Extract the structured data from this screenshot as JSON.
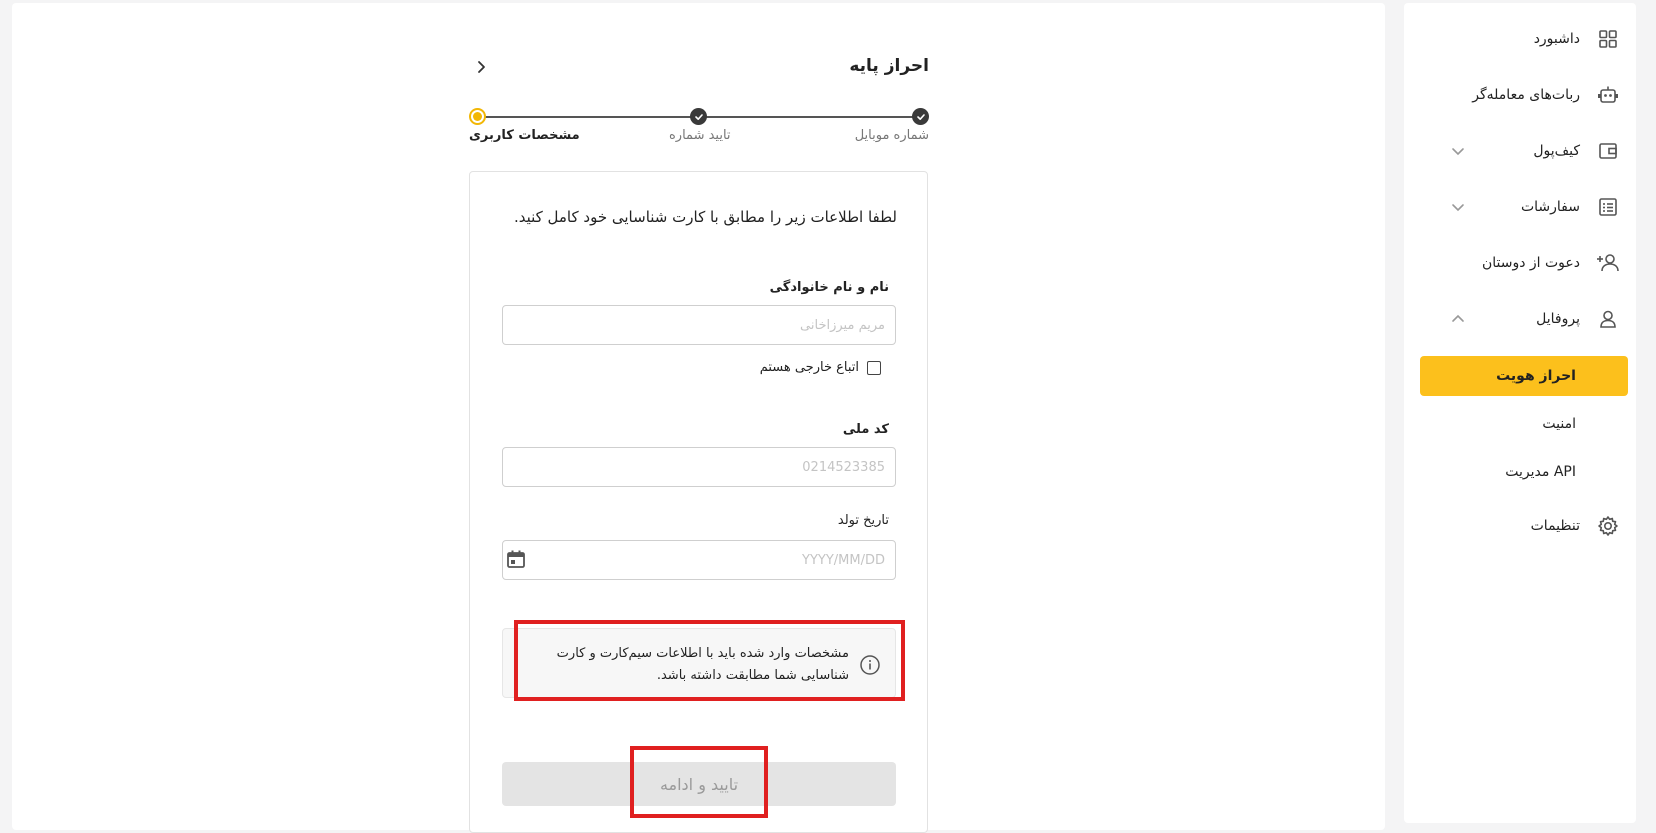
{
  "sidebar": {
    "items": [
      {
        "label": "داشبورد",
        "icon": "grid-icon"
      },
      {
        "label": "ربات‌های معامله‌گر",
        "icon": "robot-icon"
      },
      {
        "label": "کیف‌پول",
        "icon": "wallet-icon"
      },
      {
        "label": "سفارشات",
        "icon": "list-icon"
      },
      {
        "label": "دعوت از دوستان",
        "icon": "user-plus-icon"
      },
      {
        "label": "پروفایل",
        "icon": "user-icon"
      },
      {
        "label": "تنظیمات",
        "icon": "gear-icon"
      }
    ],
    "profile_sub": [
      {
        "label": "احراز هویت",
        "active": true
      },
      {
        "label": "امنیت",
        "active": false
      },
      {
        "label": "مدیریت API",
        "active": false
      }
    ]
  },
  "header": {
    "title": "احراز پایه"
  },
  "stepper": {
    "steps": [
      {
        "label": "شماره موبایل",
        "state": "done"
      },
      {
        "label": "تایید شماره",
        "state": "done"
      },
      {
        "label": "مشخصات کاربری",
        "state": "current"
      }
    ]
  },
  "form": {
    "intro": "لطفا اطلاعات زیر را مطابق با کارت شناسایی خود کامل کنید.",
    "name_label": "نام و نام خانوادگی",
    "name_placeholder": "مریم میرزاخانی",
    "foreign_label": "اتباع خارجی هستم",
    "national_code_label": "کد ملی",
    "national_code_placeholder": "0214523385",
    "birthdate_label": "تاریخ تولد",
    "birthdate_placeholder": "YYYY/MM/DD",
    "notice": "مشخصات وارد شده باید با اطلاعات سیم‌کارت و کارت شناسایی شما مطابقت داشته باشد.",
    "submit_label": "تایید و ادامه"
  },
  "colors": {
    "accent": "#fcc01c",
    "step_current": "#f2b705",
    "highlight": "#e02020",
    "submit_disabled_bg": "#e4e4e4"
  }
}
